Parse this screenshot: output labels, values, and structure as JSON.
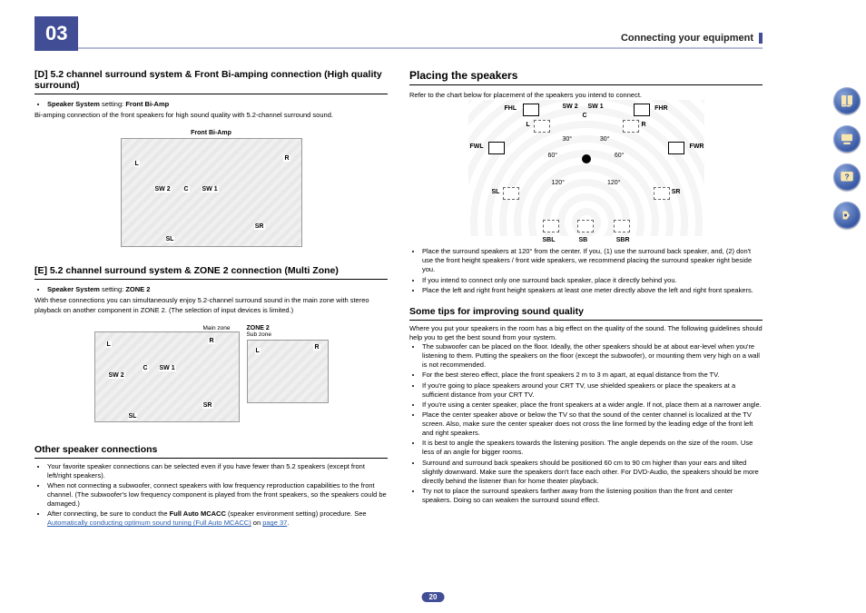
{
  "header": {
    "chapter": "03",
    "section": "Connecting your equipment"
  },
  "left": {
    "d": {
      "title": "[D] 5.2 channel surround system & Front Bi-amping connection (High quality surround)",
      "bullet": "<span class='strong'>Speaker System</span> setting: <span class='strong'>Front Bi-Amp</span>",
      "desc": "Bi-amping connection of the front speakers for high sound quality with 5.2-channel surround sound.",
      "dia_caption": "Front Bi-Amp",
      "labels": {
        "L": "L",
        "R": "R",
        "C": "C",
        "SW1": "SW 1",
        "SW2": "SW 2",
        "SL": "SL",
        "SR": "SR"
      }
    },
    "e": {
      "title": "[E] 5.2 channel surround system & ZONE 2 connection (Multi Zone)",
      "bullet": "<span class='strong'>Speaker System</span> setting: <span class='strong'>ZONE 2</span>",
      "desc": "With these connections you can simultaneously enjoy 5.2-channel surround sound in the main zone with stereo playback on another component in ZONE 2. (The selection of input devices is limited.)",
      "main_zone": "Main zone",
      "zone2": "ZONE 2",
      "sub_zone": "Sub zone",
      "labels": {
        "L": "L",
        "R": "R",
        "C": "C",
        "SW1": "SW 1",
        "SW2": "SW 2",
        "SL": "SL",
        "SR": "SR"
      }
    },
    "other": {
      "title": "Other speaker connections",
      "items": [
        "Your favorite speaker connections can be selected even if you have fewer than 5.2 speakers (except front left/right speakers).",
        "When not connecting a subwoofer, connect speakers with low frequency reproduction capabilities to the front channel. (The subwoofer's low frequency component is played from the front speakers, so the speakers could be damaged.)",
        "After connecting, be sure to conduct the <span class='strong'>Full Auto MCACC</span> (speaker environment setting) procedure. See <a href='#' class='link' data-interactable='true'>Automatically conducting optimum sound tuning (Full Auto MCACC)</a> on <a href='#' class='link' data-interactable='true'>page 37</a>."
      ]
    }
  },
  "right": {
    "placing": {
      "title": "Placing the speakers",
      "desc": "Refer to the chart below for placement of the speakers you intend to connect.",
      "labels": {
        "FHL": "FHL",
        "FHR": "FHR",
        "SW2": "SW 2",
        "SW1": "SW 1",
        "C": "C",
        "L": "L",
        "R": "R",
        "FWL": "FWL",
        "FWR": "FWR",
        "SL": "SL",
        "SR": "SR",
        "SBL": "SBL",
        "SB": "SB",
        "SBR": "SBR"
      },
      "angles": {
        "a30": "30°",
        "a60": "60°",
        "a120": "120°"
      },
      "notes": [
        "Place the surround speakers at 120° from the center. If you, (1) use the surround back speaker, and, (2) don't use the front height speakers / front wide speakers, we recommend placing the surround speaker right beside you.",
        "If you intend to connect only one surround back speaker, place it directly behind you.",
        "Place the left and right front height speakers at least one meter directly above the left and right front speakers."
      ]
    },
    "tips": {
      "title": "Some tips for improving sound quality",
      "intro": "Where you put your speakers in the room has a big effect on the quality of the sound. The following guidelines should help you to get the best sound from your system.",
      "items": [
        "The subwoofer can be placed on the floor. Ideally, the other speakers should be at about ear-level when you're listening to them. Putting the speakers on the floor (except the subwoofer), or mounting them very high on a wall is not recommended.",
        "For the best stereo effect, place the front speakers 2 m to 3 m apart, at equal distance from the TV.",
        "If you're going to place speakers around your CRT TV, use shielded speakers or place the speakers at a sufficient distance from your CRT TV.",
        "If you're using a center speaker, place the front speakers at a wider angle. If not, place them at a narrower angle.",
        "Place the center speaker above or below the TV so that the sound of the center channel is localized at the TV screen. Also, make sure the center speaker does not cross the line formed by the leading edge of the front left and right speakers.",
        "It is best to angle the speakers towards the listening position. The angle depends on the size of the room. Use less of an angle for bigger rooms.",
        "Surround and surround back speakers should be positioned 60 cm to 90 cm higher than your ears and tilted slightly downward. Make sure the speakers don't face each other. For DVD-Audio, the speakers should be more directly behind the listener than for home theater playback.",
        "Try not to place the surround speakers farther away from the listening position than the front and center speakers. Doing so can weaken the surround sound effect."
      ]
    }
  },
  "page_number": "20"
}
